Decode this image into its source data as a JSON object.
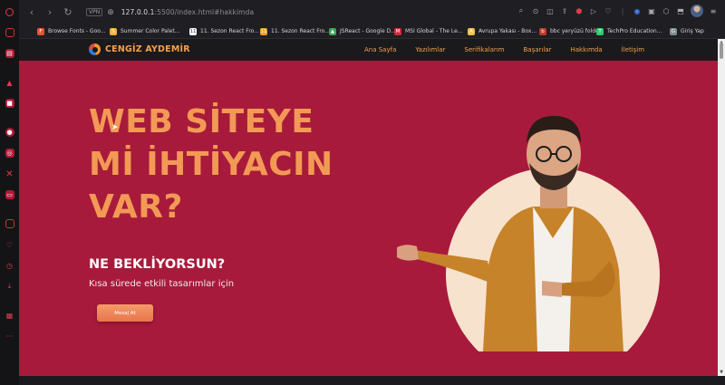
{
  "browser": {
    "url_host": "127.0.0.1",
    "url_path": ":5500/index.html#hakkimda",
    "vpn_label": "VPN",
    "sidebar_icons": [
      "opera-logo-icon",
      "bag-icon",
      "news-icon",
      "triangle-icon",
      "square-icon",
      "circle-icon",
      "instagram-icon",
      "x-icon",
      "tv-icon",
      "calendar-icon",
      "heart-icon",
      "clock-icon",
      "download-icon",
      "grid-icon",
      "more-icon"
    ],
    "bookmarks": [
      {
        "label": "Browse Fonts - Goo...",
        "icon_color": "#e4572e",
        "icon": "F"
      },
      {
        "label": "Summer Color Palet...",
        "icon_color": "#f6b13d",
        "icon": "S"
      },
      {
        "label": "11. Sezon React Fro...",
        "icon_color": "#ffffff",
        "icon": "11"
      },
      {
        "label": "11. Sezon React Fro...",
        "icon_color": "#f4a026",
        "icon": "11"
      },
      {
        "label": "JSReact - Google D...",
        "icon_color": "#34a853",
        "icon": "▲"
      },
      {
        "label": "MSI Global - The Le...",
        "icon_color": "#d42a3a",
        "icon": "M"
      },
      {
        "label": "Avrupa Yakası - Box...",
        "icon_color": "#f0c14b",
        "icon": "A"
      },
      {
        "label": "bbc yeryüzü folder",
        "icon_color": "#c0392b",
        "icon": "b"
      },
      {
        "label": "TechPro Education...",
        "icon_color": "#2ecc71",
        "icon": "T"
      },
      {
        "label": "Giriş Yap",
        "icon_color": "#7f8c8d",
        "icon": "G"
      }
    ]
  },
  "site": {
    "brand": "CENGİZ AYDEMİR",
    "menu": [
      "Ana Sayfa",
      "Yazılımlar",
      "Serifikalarım",
      "Başarılar",
      "Hakkımda",
      "İletişim"
    ],
    "headline": [
      "WEB SİTEYE",
      "Mİ İHTİYACIN",
      "VAR?"
    ],
    "subhead": "NE BEKLİYORSUN?",
    "tagline": "Kısa sürede etkili tasarımlar için",
    "cta": "Mesaj At",
    "colors": {
      "background": "#a81a3b",
      "accent": "#f29a55",
      "nav": "#1a1a1c"
    }
  }
}
